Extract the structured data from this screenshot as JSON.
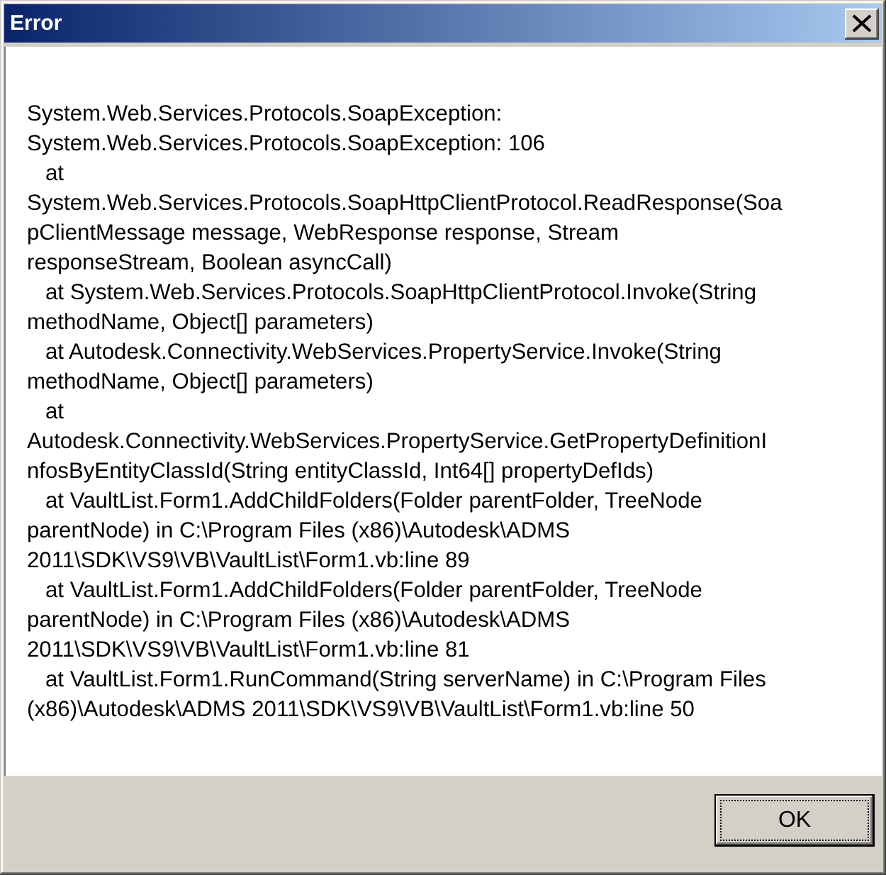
{
  "window": {
    "title": "Error"
  },
  "message_lines": [
    "System.Web.Services.Protocols.SoapException:",
    "System.Web.Services.Protocols.SoapException: 106",
    "   at",
    "System.Web.Services.Protocols.SoapHttpClientProtocol.ReadResponse(Soa",
    "pClientMessage message, WebResponse response, Stream",
    "responseStream, Boolean asyncCall)",
    "   at System.Web.Services.Protocols.SoapHttpClientProtocol.Invoke(String",
    "methodName, Object[] parameters)",
    "   at Autodesk.Connectivity.WebServices.PropertyService.Invoke(String",
    "methodName, Object[] parameters)",
    "   at",
    "Autodesk.Connectivity.WebServices.PropertyService.GetPropertyDefinitionI",
    "nfosByEntityClassId(String entityClassId, Int64[] propertyDefIds)",
    "   at VaultList.Form1.AddChildFolders(Folder parentFolder, TreeNode",
    "parentNode) in C:\\Program Files (x86)\\Autodesk\\ADMS",
    "2011\\SDK\\VS9\\VB\\VaultList\\Form1.vb:line 89",
    "   at VaultList.Form1.AddChildFolders(Folder parentFolder, TreeNode",
    "parentNode) in C:\\Program Files (x86)\\Autodesk\\ADMS",
    "2011\\SDK\\VS9\\VB\\VaultList\\Form1.vb:line 81",
    "   at VaultList.Form1.RunCommand(String serverName) in C:\\Program Files",
    "(x86)\\Autodesk\\ADMS 2011\\SDK\\VS9\\VB\\VaultList\\Form1.vb:line 50"
  ],
  "buttons": [
    {
      "label": "OK",
      "default": true,
      "focused": true
    }
  ]
}
